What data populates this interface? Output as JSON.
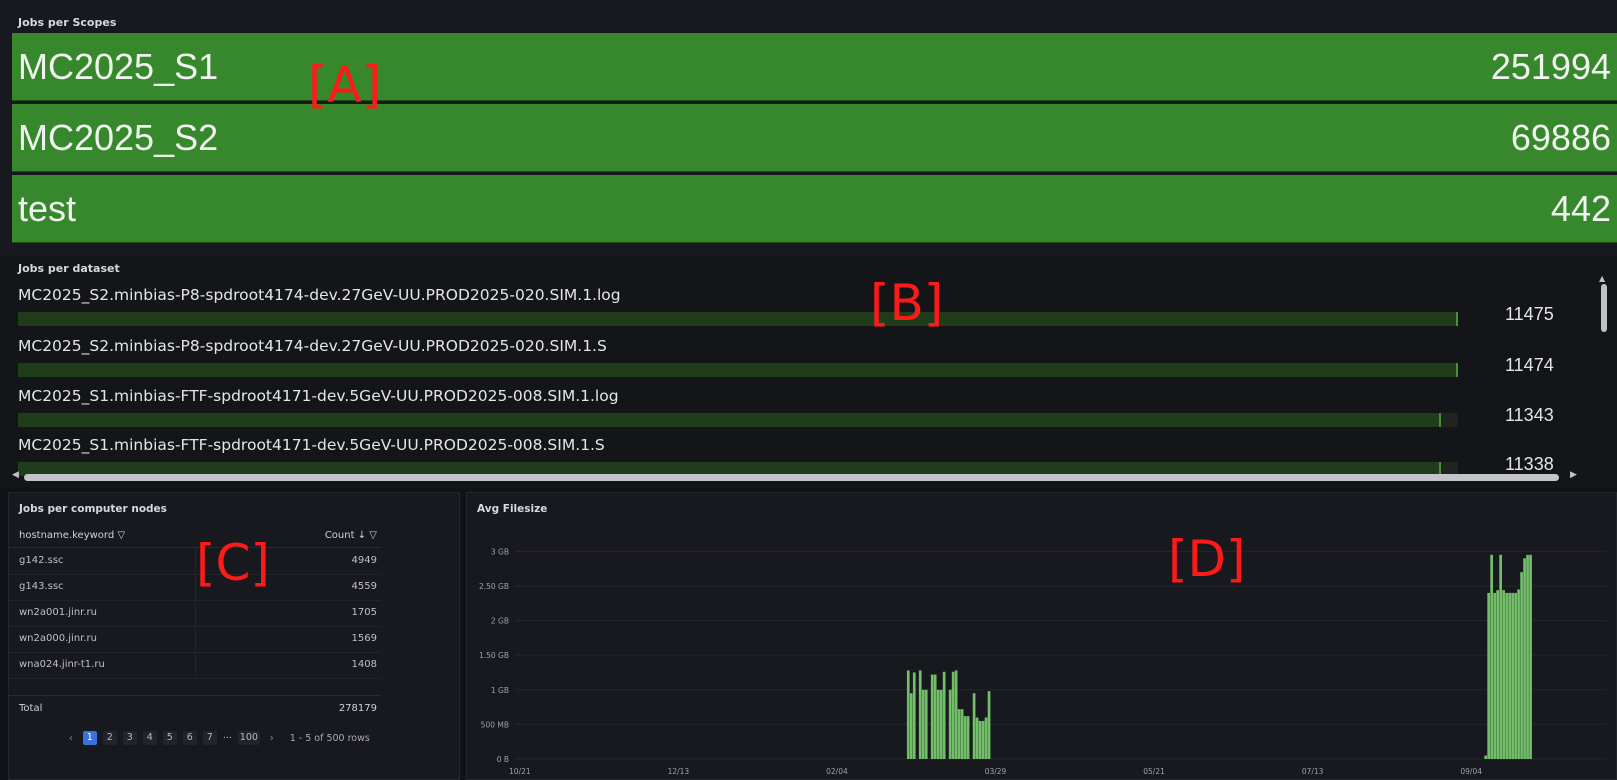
{
  "annotations": [
    "[A]",
    "[B]",
    "[C]",
    "[D]"
  ],
  "colors": {
    "scope_bar": "#37872d",
    "chart_bar": "#73bf69",
    "highlight": "#ff1a1a",
    "page_active": "#3d71d9"
  },
  "scopes_panel": {
    "title": "Jobs per Scopes",
    "rows": [
      {
        "name": "MC2025_S1",
        "value": "251994"
      },
      {
        "name": "MC2025_S2",
        "value": "69886"
      },
      {
        "name": "test",
        "value": "442"
      }
    ]
  },
  "dataset_panel": {
    "title": "Jobs per dataset",
    "items": [
      {
        "name": "MC2025_S2.minbias-P8-spdroot4174-dev.27GeV-UU.PROD2025-020.SIM.1.log",
        "value": "11475",
        "fraction": 1.0
      },
      {
        "name": "MC2025_S2.minbias-P8-spdroot4174-dev.27GeV-UU.PROD2025-020.SIM.1.S",
        "value": "11474",
        "fraction": 0.9999
      },
      {
        "name": "MC2025_S1.minbias-FTF-spdroot4171-dev.5GeV-UU.PROD2025-008.SIM.1.log",
        "value": "11343",
        "fraction": 0.9885
      },
      {
        "name": "MC2025_S1.minbias-FTF-spdroot4171-dev.5GeV-UU.PROD2025-008.SIM.1.S",
        "value": "11338",
        "fraction": 0.9881
      }
    ]
  },
  "nodes_panel": {
    "title": "Jobs per computer nodes",
    "columns": [
      "hostname.keyword",
      "Count"
    ],
    "filter_icon": "funnel-icon",
    "sort_icon": "arrow-down-icon",
    "rows": [
      {
        "host": "g142.ssc",
        "count": "4949"
      },
      {
        "host": "g143.ssc",
        "count": "4559"
      },
      {
        "host": "wn2a001.jinr.ru",
        "count": "1705"
      },
      {
        "host": "wn2a000.jinr.ru",
        "count": "1569"
      },
      {
        "host": "wna024.jinr-t1.ru",
        "count": "1408"
      }
    ],
    "total_label": "Total",
    "total_value": "278179",
    "pagination": {
      "prev": "‹",
      "pages": [
        "1",
        "2",
        "3",
        "4",
        "5",
        "6",
        "7"
      ],
      "ellipsis": "···",
      "last": "100",
      "next": "›",
      "rows_info": "1 - 5 of 500 rows",
      "current_page": 1
    }
  },
  "chart_data": {
    "type": "bar",
    "title": "Avg Filesize",
    "y_ticks": [
      "0 B",
      "500 MB",
      "1 GB",
      "1.50 GB",
      "2 GB",
      "2.50 GB",
      "3 GB"
    ],
    "x_ticks": [
      "10/21",
      "12/13",
      "02/04",
      "03/29",
      "05/21",
      "07/13",
      "09/04"
    ],
    "ylim_gb": [
      0,
      3.15
    ],
    "grid": true,
    "x_unit": "days since 10/21",
    "x_range_days": [
      0,
      365
    ],
    "series": [
      {
        "name": "Avg Filesize",
        "unit": "GB",
        "points": [
          [
            131,
            1.28
          ],
          [
            132,
            0.95
          ],
          [
            133,
            1.25
          ],
          [
            135,
            1.28
          ],
          [
            136,
            1.0
          ],
          [
            137,
            1.0
          ],
          [
            139,
            1.22
          ],
          [
            140,
            1.22
          ],
          [
            141,
            1.0
          ],
          [
            142,
            1.0
          ],
          [
            143,
            1.26
          ],
          [
            145,
            1.0
          ],
          [
            146,
            1.26
          ],
          [
            147,
            1.28
          ],
          [
            148,
            0.72
          ],
          [
            149,
            0.72
          ],
          [
            150,
            0.62
          ],
          [
            151,
            0.62
          ],
          [
            153,
            0.95
          ],
          [
            154,
            0.6
          ],
          [
            155,
            0.55
          ],
          [
            156,
            0.55
          ],
          [
            157,
            0.6
          ],
          [
            158,
            0.98
          ],
          [
            324,
            0.05
          ],
          [
            325,
            2.4
          ],
          [
            326,
            2.95
          ],
          [
            327,
            2.4
          ],
          [
            328,
            2.44
          ],
          [
            329,
            2.95
          ],
          [
            330,
            2.44
          ],
          [
            331,
            2.4
          ],
          [
            332,
            2.4
          ],
          [
            333,
            2.4
          ],
          [
            334,
            2.4
          ],
          [
            335,
            2.45
          ],
          [
            336,
            2.7
          ],
          [
            337,
            2.9
          ],
          [
            338,
            2.95
          ],
          [
            339,
            2.95
          ]
        ]
      }
    ]
  }
}
